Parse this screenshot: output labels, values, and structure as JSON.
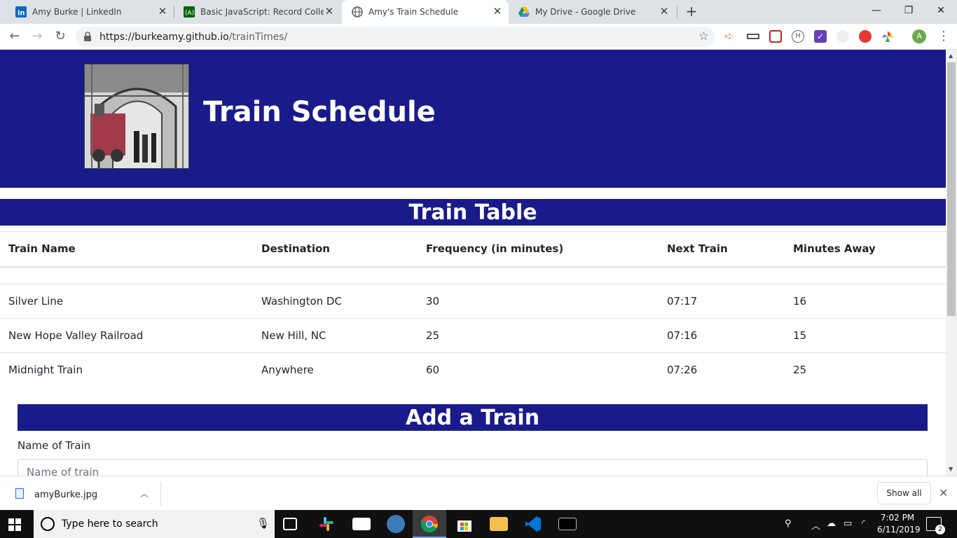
{
  "browser": {
    "tabs": [
      {
        "title": "Amy Burke | LinkedIn",
        "icon": "linkedin-icon",
        "color": "#0a66c2"
      },
      {
        "title": "Basic JavaScript: Record Collectio",
        "icon": "freecodecamp-icon",
        "color": "#006400"
      },
      {
        "title": "Amy's Train Schedule",
        "icon": "globe-icon",
        "color": "#5f6368"
      },
      {
        "title": "My Drive - Google Drive",
        "icon": "google-drive-icon",
        "color": "#fbbc04"
      }
    ],
    "url_host": "https://burkeamy.github.io",
    "url_path": "/trainTimes/",
    "profile_initial": "A"
  },
  "page": {
    "header_title": "Train Schedule",
    "table_title": "Train Table",
    "columns": [
      "Train Name",
      "Destination",
      "Frequency (in minutes)",
      "Next Train",
      "Minutes Away"
    ],
    "rows": [
      [
        "Silver Line",
        "Washington DC",
        "30",
        "07:17",
        "16"
      ],
      [
        "New Hope Valley Railroad",
        "New Hill, NC",
        "25",
        "07:16",
        "15"
      ],
      [
        "Midnight Train",
        "Anywhere",
        "60",
        "07:26",
        "25"
      ]
    ],
    "form_title": "Add a Train",
    "name_label": "Name of Train",
    "name_placeholder": "Name of train",
    "colors": {
      "primary": "#191b8a"
    }
  },
  "downloads": {
    "file_name": "amyBurke.jpg",
    "show_all": "Show all"
  },
  "taskbar": {
    "search_placeholder": "Type here to search",
    "time": "7:02 PM",
    "date": "6/11/2019",
    "notification_count": "2"
  }
}
